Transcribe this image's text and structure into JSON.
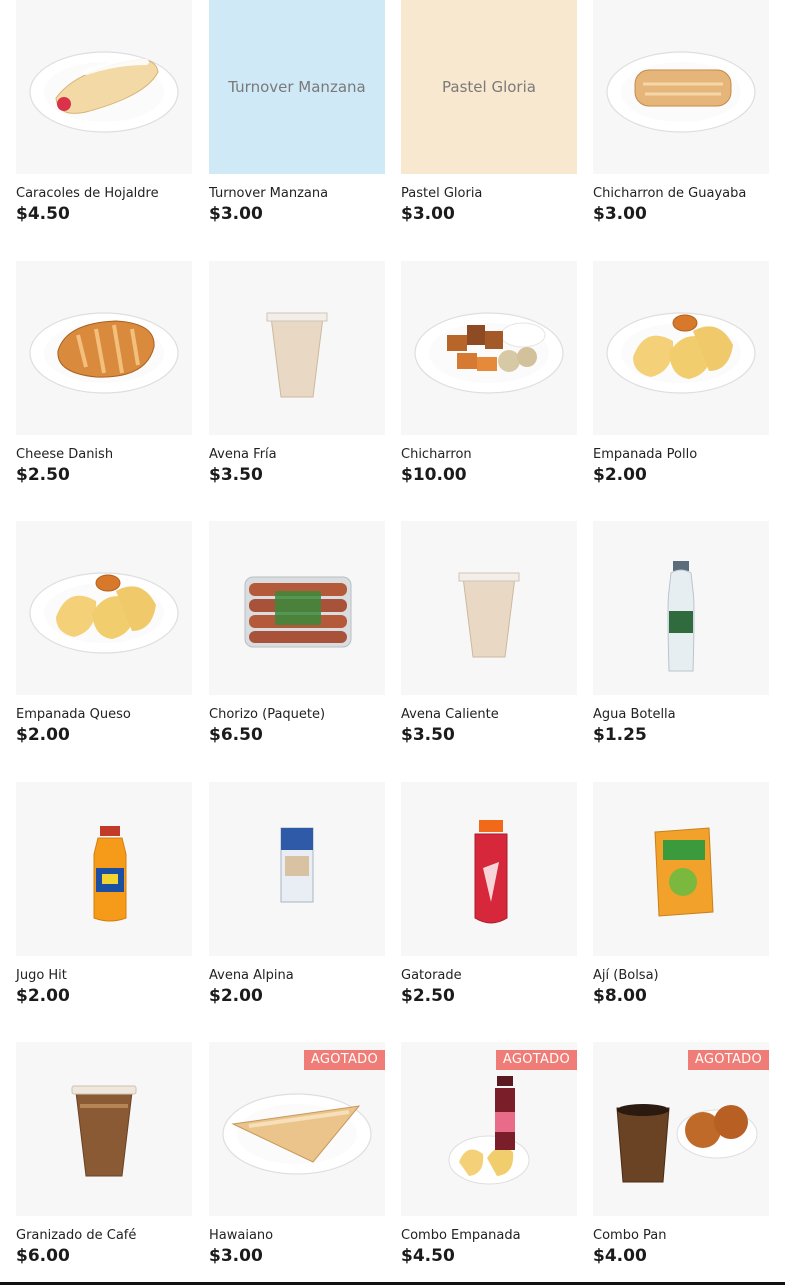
{
  "products": [
    {
      "name": "Caracoles de Hojaldre",
      "price": "$4.50",
      "icon": "pastry-roll-icon",
      "placeholder": "",
      "sold_out": ""
    },
    {
      "name": "Turnover Manzana",
      "price": "$3.00",
      "icon": "",
      "placeholder": "Turnover Manzana",
      "placeholder_color": "#cfe9f7",
      "sold_out": ""
    },
    {
      "name": "Pastel Gloria",
      "price": "$3.00",
      "icon": "",
      "placeholder": "Pastel Gloria",
      "placeholder_color": "#f8e8cf",
      "sold_out": ""
    },
    {
      "name": "Chicharron de Guayaba",
      "price": "$3.00",
      "icon": "puff-pastry-icon",
      "placeholder": "",
      "sold_out": ""
    },
    {
      "name": "Cheese Danish",
      "price": "$2.50",
      "icon": "danish-icon",
      "placeholder": "",
      "sold_out": ""
    },
    {
      "name": "Avena Fría",
      "price": "$3.50",
      "icon": "cup-drink-icon",
      "placeholder": "",
      "sold_out": ""
    },
    {
      "name": "Chicharron",
      "price": "$10.00",
      "icon": "chicharron-plate-icon",
      "placeholder": "",
      "sold_out": ""
    },
    {
      "name": "Empanada Pollo",
      "price": "$2.00",
      "icon": "empanada-plate-icon",
      "placeholder": "",
      "sold_out": ""
    },
    {
      "name": "Empanada Queso",
      "price": "$2.00",
      "icon": "empanada-plate-icon",
      "placeholder": "",
      "sold_out": ""
    },
    {
      "name": "Chorizo (Paquete)",
      "price": "$6.50",
      "icon": "sausage-pack-icon",
      "placeholder": "",
      "sold_out": ""
    },
    {
      "name": "Avena Caliente",
      "price": "$3.50",
      "icon": "cup-drink-icon",
      "placeholder": "",
      "sold_out": ""
    },
    {
      "name": "Agua Botella",
      "price": "$1.25",
      "icon": "water-bottle-icon",
      "placeholder": "",
      "sold_out": ""
    },
    {
      "name": "Jugo Hit",
      "price": "$2.00",
      "icon": "juice-bottle-icon",
      "placeholder": "",
      "sold_out": ""
    },
    {
      "name": "Avena Alpina",
      "price": "$2.00",
      "icon": "carton-icon",
      "placeholder": "",
      "sold_out": ""
    },
    {
      "name": "Gatorade",
      "price": "$2.50",
      "icon": "sports-drink-icon",
      "placeholder": "",
      "sold_out": ""
    },
    {
      "name": "Ají (Bolsa)",
      "price": "$8.00",
      "icon": "sauce-bag-icon",
      "placeholder": "",
      "sold_out": ""
    },
    {
      "name": "Granizado de Café",
      "price": "$6.00",
      "icon": "coffee-cup-icon",
      "placeholder": "",
      "sold_out": ""
    },
    {
      "name": "Hawaiano",
      "price": "$3.00",
      "icon": "triangle-pastry-icon",
      "placeholder": "",
      "sold_out": "AGOTADO"
    },
    {
      "name": "Combo Empanada",
      "price": "$4.50",
      "icon": "combo-empanada-icon",
      "placeholder": "",
      "sold_out": "AGOTADO"
    },
    {
      "name": "Combo Pan",
      "price": "$4.00",
      "icon": "combo-pan-icon",
      "placeholder": "",
      "sold_out": "AGOTADO"
    }
  ],
  "colors": {
    "badge": "#f07c78",
    "thumb_bg": "#f7f7f7"
  }
}
